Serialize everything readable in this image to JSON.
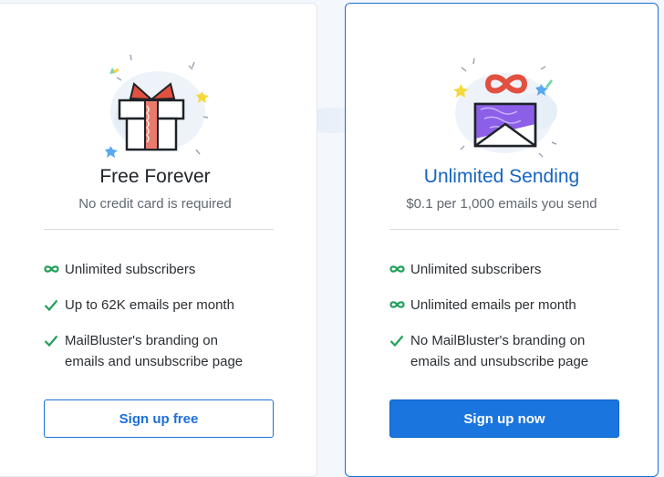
{
  "plans": {
    "free": {
      "icon": "gift-box-icon",
      "title": "Free Forever",
      "subtitle": "No credit card is required",
      "features": [
        {
          "icon": "infinity-icon",
          "text": "Unlimited subscribers"
        },
        {
          "icon": "check-icon",
          "text": "Up to 62K emails per month"
        },
        {
          "icon": "check-icon",
          "text": "MailBluster's branding on\nemails and unsubscribe page"
        }
      ],
      "button": "Sign up free"
    },
    "unlimited": {
      "icon": "envelope-infinity-icon",
      "title": "Unlimited Sending",
      "subtitle": "$0.1 per 1,000 emails you send",
      "features": [
        {
          "icon": "infinity-icon",
          "text": "Unlimited subscribers"
        },
        {
          "icon": "infinity-icon",
          "text": "Unlimited emails per month"
        },
        {
          "icon": "check-icon",
          "text": "No MailBluster's branding on\nemails and unsubscribe page"
        }
      ],
      "button": "Sign up now"
    }
  },
  "colors": {
    "accent": "#1b75de",
    "title_blue": "#1565c0",
    "check_green": "#21a05a",
    "ribbon_red": "#e2503f"
  }
}
